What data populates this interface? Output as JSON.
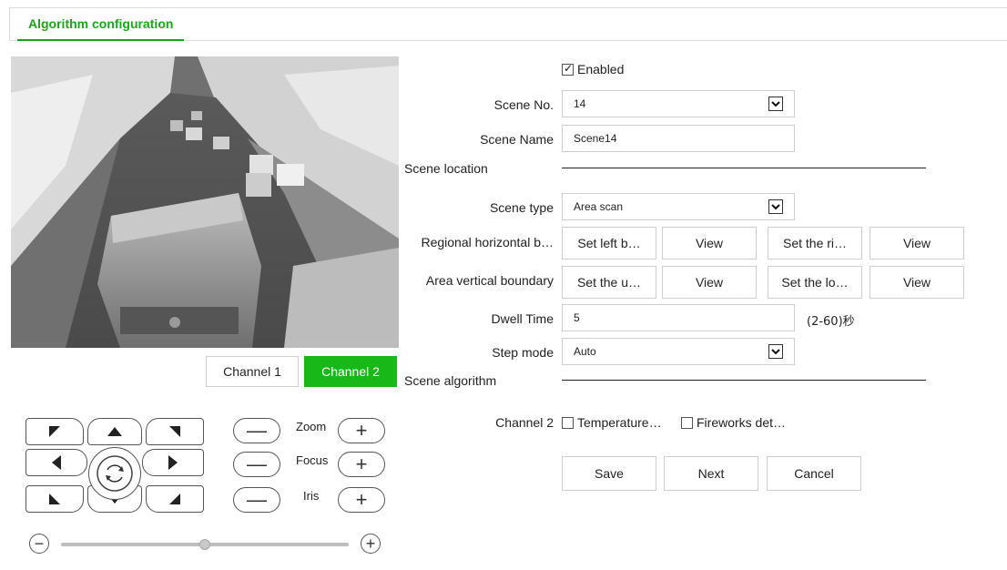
{
  "tab": {
    "title": "Algorithm configuration"
  },
  "channels": {
    "channel1": "Channel 1",
    "channel2": "Channel 2",
    "active": "channel2"
  },
  "lens": {
    "zoom": "Zoom",
    "focus": "Focus",
    "iris": "Iris",
    "minus": "—",
    "plus": "+"
  },
  "speed": {
    "minus": "−",
    "plus": "+",
    "value_percent": 50
  },
  "form": {
    "enabled_label": "Enabled",
    "enabled": true,
    "scene_no_label": "Scene No.",
    "scene_no_value": "14",
    "scene_name_label": "Scene Name",
    "scene_name_value": "Scene14",
    "scene_location_label": "Scene location",
    "scene_type_label": "Scene type",
    "scene_type_value": "Area scan",
    "regional_horizontal_label": "Regional horizontal b…",
    "set_left_label": "Set left b…",
    "view_label": "View",
    "set_right_label": "Set the ri…",
    "area_vertical_label": "Area vertical boundary",
    "set_upper_label": "Set the u…",
    "set_lower_label": "Set the lo…",
    "dwell_time_label": "Dwell Time",
    "dwell_time_value": "5",
    "dwell_time_hint": "(2-60)秒",
    "step_mode_label": "Step mode",
    "step_mode_value": "Auto",
    "scene_algorithm_label": "Scene algorithm",
    "channel_label": "Channel 2",
    "temperature_label": "Temperature…",
    "temperature_checked": false,
    "fireworks_label": "Fireworks det…",
    "fireworks_checked": false
  },
  "actions": {
    "save": "Save",
    "next": "Next",
    "cancel": "Cancel"
  },
  "colors": {
    "accent": "#1aa51a",
    "active_button": "#18b818"
  }
}
